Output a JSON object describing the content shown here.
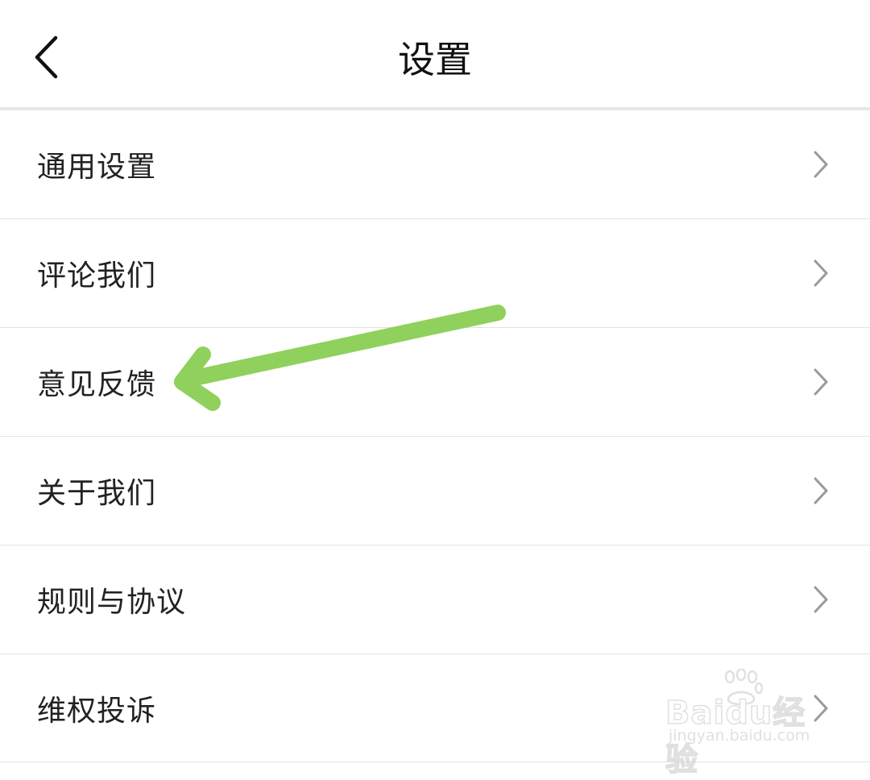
{
  "header": {
    "title": "设置",
    "back_icon": "chevron-left-icon"
  },
  "settings": {
    "items": [
      {
        "label": "通用设置",
        "icon": "chevron-right-icon"
      },
      {
        "label": "评论我们",
        "icon": "chevron-right-icon"
      },
      {
        "label": "意见反馈",
        "icon": "chevron-right-icon"
      },
      {
        "label": "关于我们",
        "icon": "chevron-right-icon"
      },
      {
        "label": "规则与协议",
        "icon": "chevron-right-icon"
      },
      {
        "label": "维权投诉",
        "icon": "chevron-right-icon"
      }
    ]
  },
  "annotation": {
    "type": "green-arrow",
    "points_to": "意见反馈",
    "color": "#8fd15c"
  },
  "watermark": {
    "logo_text": "Baidu经验",
    "url": "jingyan.baidu.com"
  },
  "colors": {
    "background": "#ffffff",
    "divider": "#e3e3e3",
    "chevron": "#9a9a9a",
    "arrow": "#8fd15c"
  }
}
